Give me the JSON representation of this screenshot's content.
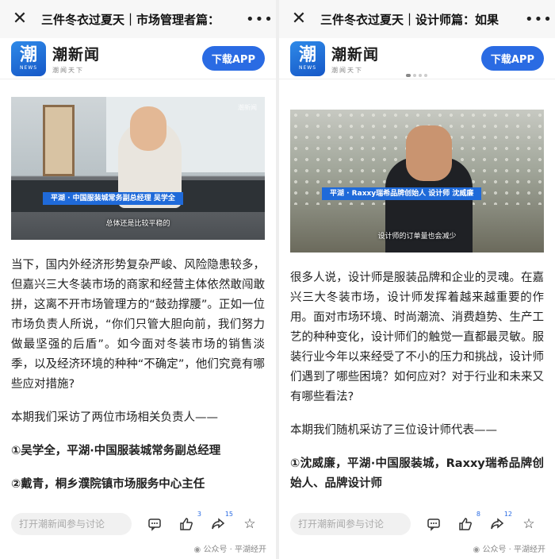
{
  "left": {
    "title": "三件冬衣过夏天｜市场管理者篇：",
    "brand": {
      "name": "潮新闻",
      "slogan": "潮闻天下",
      "logo_glyph": "潮",
      "logo_sub": "NEWS"
    },
    "download_label": "下载APP",
    "photo": {
      "watermark": "潮新闻",
      "caption": "平湖 · 中国服装城常务副总经理 吴学全",
      "subtitle": "总体还是比较平稳的"
    },
    "paragraphs": [
      "当下，国内外经济形势复杂严峻、风险隐患较多，但嘉兴三大冬装市场的商家和经营主体依然敢闯敢拼，这离不开市场管理方的“鼓劲撑腰”。正如一位市场负责人所说，“你们只管大胆向前，我们努力做最坚强的后盾”。如今面对冬装市场的销售淡季，以及经济环境的种种“不确定”，他们究竟有哪些应对措施?",
      "本期我们采访了两位市场相关负责人——"
    ],
    "bold_items": [
      "①吴学全，平湖·中国服装城常务副总经理",
      "②戴青，桐乡濮院镇市场服务中心主任"
    ],
    "comment_placeholder": "打开潮新闻参与讨论",
    "like_count": "3",
    "share_count": "15",
    "source": "公众号 · 平湖经开"
  },
  "right": {
    "title": "三件冬衣过夏天｜设计师篇：如果",
    "brand": {
      "name": "潮新闻",
      "slogan": "潮闻天下",
      "logo_glyph": "潮",
      "logo_sub": "NEWS"
    },
    "download_label": "下载APP",
    "photo": {
      "caption": "平湖 · Raxxy瑞希品牌创始人 设计师 沈威廉",
      "subtitle": "设计师的订单量也会减少"
    },
    "paragraphs": [
      "很多人说，设计师是服装品牌和企业的灵魂。在嘉兴三大冬装市场，设计师发挥着越来越重要的作用。面对市场环境、时尚潮流、消费趋势、生产工艺的种种变化，设计师们的触觉一直都最灵敏。服装行业今年以来经受了不小的压力和挑战，设计师们遇到了哪些困境？如何应对？对于行业和未来又有哪些看法?",
      "本期我们随机采访了三位设计师代表——"
    ],
    "bold_items": [
      "①沈威廉，平湖·中国服装城，Raxxy瑞希品牌创始人、品牌设计师"
    ],
    "comment_placeholder": "打开潮新闻参与讨论",
    "like_count": "8",
    "share_count": "12",
    "source": "公众号 · 平湖经开"
  },
  "colors": {
    "accent": "#2a6be3",
    "caption_bg": "#1f6ad9"
  },
  "icons": [
    "close-icon",
    "more-icon",
    "comment-icon",
    "like-icon",
    "share-icon",
    "star-icon",
    "wechat-icon"
  ]
}
